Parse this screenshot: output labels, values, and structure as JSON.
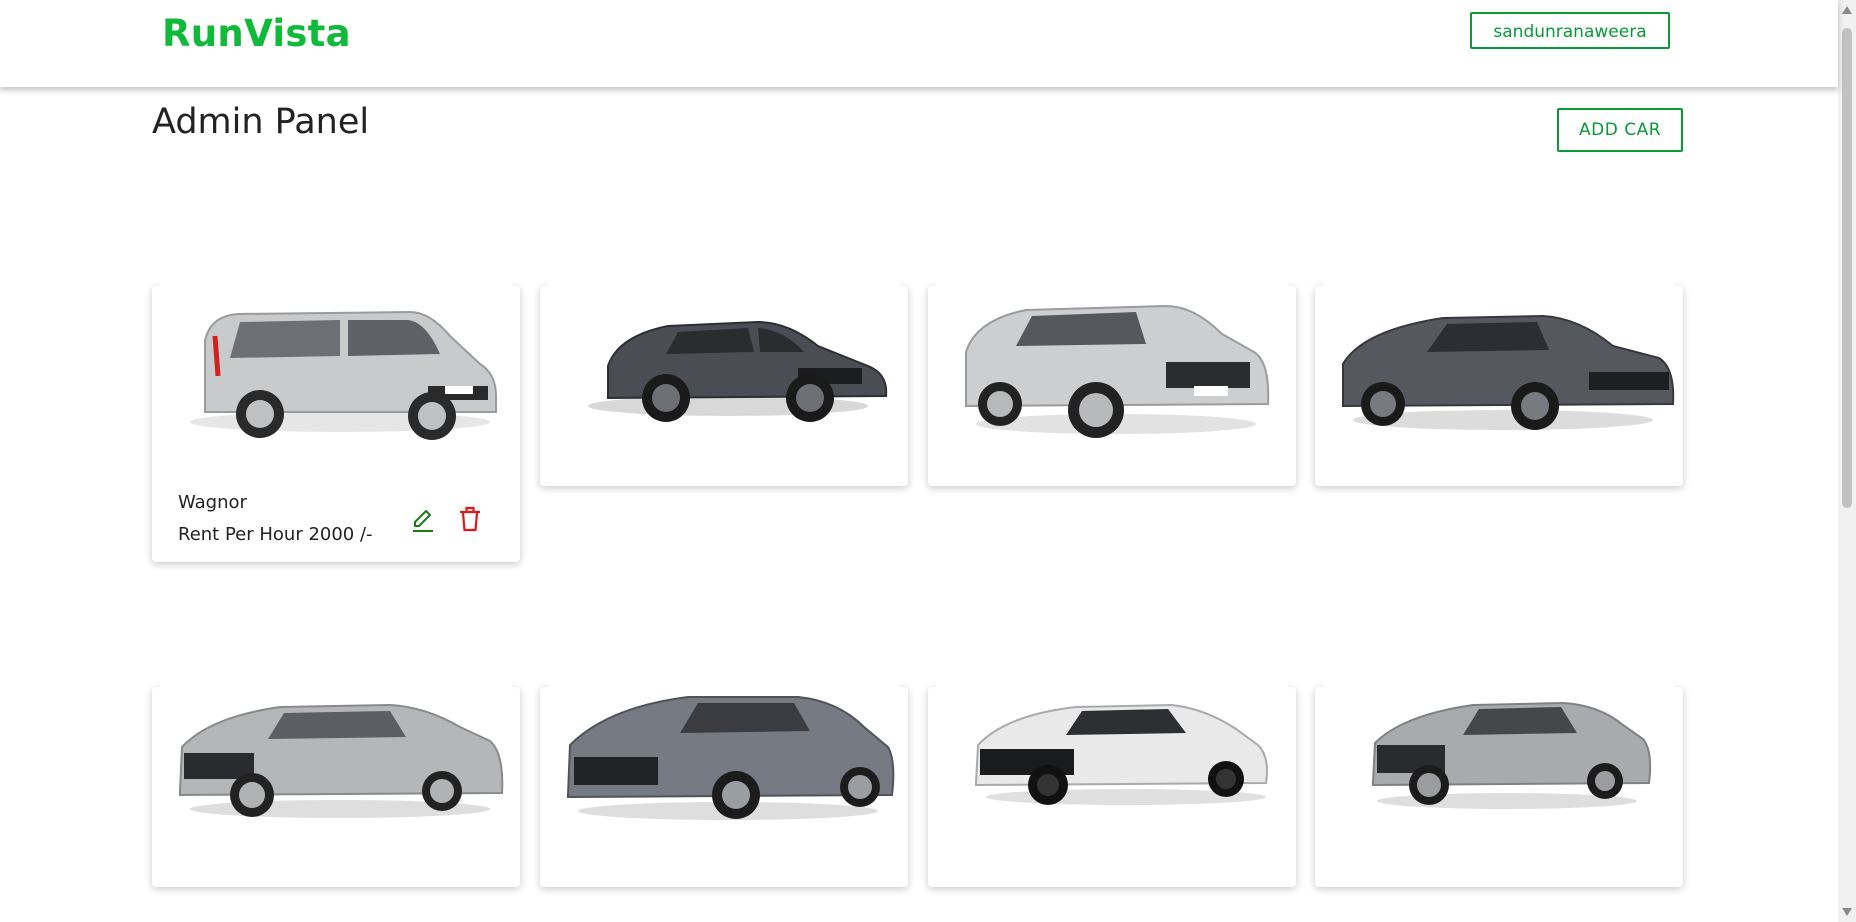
{
  "header": {
    "brand": "RunVista",
    "user_label": "sandunranaweera"
  },
  "main": {
    "title": "Admin Panel",
    "add_car_label": "ADD CAR"
  },
  "colors": {
    "brand": "#0fba3a",
    "accent": "#0a9a3a",
    "delete": "#e01818",
    "edit": "#1a7a1a"
  },
  "cars": [
    {
      "name": "Wagnor",
      "rent": "Rent Per Hour 2000 /-",
      "color": "silver-hatchback",
      "expanded": true
    },
    {
      "color": "dark-sedan"
    },
    {
      "color": "silver-hatchback"
    },
    {
      "color": "dark-sedan"
    },
    {
      "color": "silver-sedan"
    },
    {
      "color": "grey-sedan"
    },
    {
      "color": "white-sedan"
    },
    {
      "color": "silver-sedan"
    }
  ],
  "icons": {
    "edit": "pencil-icon",
    "delete": "trash-icon"
  }
}
